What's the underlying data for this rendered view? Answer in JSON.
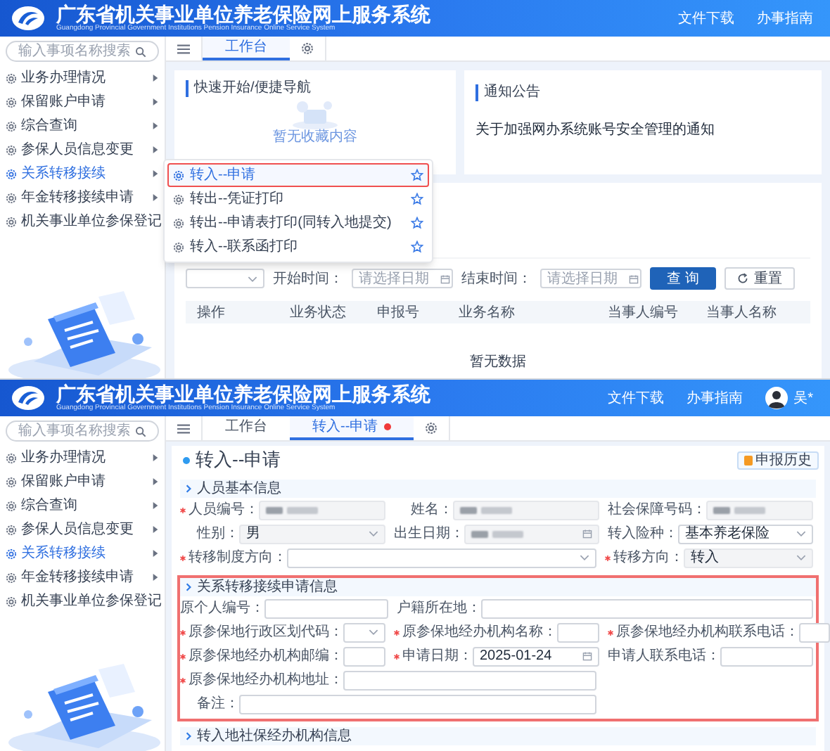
{
  "top_screen": {
    "header": {
      "title": "广东省机关事业单位养老保险网上服务系统",
      "subtitle": "Guangdong Provincial Government Institutions Pension Insurance Online Service System",
      "links": [
        "文件下载",
        "办事指南"
      ]
    },
    "sidebar": {
      "search_placeholder": "输入事项名称搜索",
      "items": [
        {
          "label": "业务办理情况",
          "selected": false
        },
        {
          "label": "保留账户申请",
          "selected": false
        },
        {
          "label": "综合查询",
          "selected": false
        },
        {
          "label": "参保人员信息变更",
          "selected": false
        },
        {
          "label": "关系转移接续",
          "selected": true
        },
        {
          "label": "年金转移接续申请",
          "selected": false
        },
        {
          "label": "机关事业单位参保登记",
          "selected": false
        }
      ]
    },
    "tabs": [
      {
        "kind": "menu",
        "selected": false
      },
      {
        "kind": "text",
        "label": "工作台",
        "selected": true,
        "dot": false
      },
      {
        "kind": "settings",
        "selected": false
      }
    ],
    "quick_nav": {
      "title": "快速开始/便捷导航",
      "empty_text": "暂无收藏内容"
    },
    "notices": {
      "title": "通知公告",
      "items": [
        "关于加强网办系统账号安全管理的通知"
      ]
    },
    "filters": [
      {
        "kind": "select"
      },
      {
        "kind": "date",
        "label": "开始时间：",
        "placeholder": "请选择日期"
      },
      {
        "kind": "date",
        "label": "结束时间：",
        "placeholder": "请选择日期"
      }
    ],
    "buttons": [
      {
        "kind": "primary",
        "label": "查 询"
      },
      {
        "kind": "reset",
        "label": "重置"
      }
    ],
    "table": {
      "columns": [
        "操作",
        "业务状态",
        "申报号",
        "业务名称",
        "当事人编号",
        "当事人名称"
      ],
      "empty_text": "暂无数据"
    },
    "popup_menu": {
      "items": [
        {
          "label": "转入--申请",
          "highlighted": true
        },
        {
          "label": "转出--凭证打印",
          "highlighted": false
        },
        {
          "label": "转出--申请表打印(同转入地提交)",
          "highlighted": false
        },
        {
          "label": "转入--联系函打印",
          "highlighted": false
        }
      ]
    }
  },
  "bottom_screen": {
    "header": {
      "title": "广东省机关事业单位养老保险网上服务系统",
      "subtitle": "Guangdong Provincial Government Institutions Pension Insurance Online Service System",
      "links": [
        "文件下载",
        "办事指南"
      ],
      "user": {
        "name": "吴*"
      }
    },
    "sidebar": {
      "search_placeholder": "输入事项名称搜索",
      "items": [
        {
          "label": "业务办理情况",
          "selected": false
        },
        {
          "label": "保留账户申请",
          "selected": false
        },
        {
          "label": "综合查询",
          "selected": false
        },
        {
          "label": "参保人员信息变更",
          "selected": false
        },
        {
          "label": "关系转移接续",
          "selected": true
        },
        {
          "label": "年金转移接续申请",
          "selected": false
        },
        {
          "label": "机关事业单位参保登记",
          "selected": false
        }
      ]
    },
    "tabs": [
      {
        "kind": "menu",
        "selected": false
      },
      {
        "kind": "text",
        "label": "工作台",
        "selected": false,
        "dot": false
      },
      {
        "kind": "text",
        "label": "转入--申请",
        "selected": true,
        "dot": true
      },
      {
        "kind": "settings",
        "selected": false
      }
    ],
    "page": {
      "title": "转入--申请",
      "history_button": "申报历史"
    },
    "sections": [
      {
        "title": "人员基本信息",
        "highlighted": false,
        "rows": [
          [
            {
              "label": "人员编号：",
              "kind": "text",
              "required": true,
              "disabled": true,
              "redacted": true
            },
            {
              "label": "姓名：",
              "kind": "text",
              "required": false,
              "disabled": true,
              "redacted": true
            },
            {
              "label": "社会保障号码：",
              "kind": "text",
              "required": false,
              "disabled": true,
              "redacted": true
            }
          ],
          [
            {
              "label": "性别：",
              "kind": "select",
              "required": false,
              "disabled": true,
              "value": "男"
            },
            {
              "label": "出生日期：",
              "kind": "date",
              "required": false,
              "disabled": true,
              "redacted": true
            },
            {
              "label": "转入险种：",
              "kind": "select",
              "required": false,
              "disabled": false,
              "value": "基本养老保险"
            }
          ],
          [
            {
              "label": "转移制度方向：",
              "kind": "select",
              "required": true,
              "disabled": false,
              "wide": true
            },
            "",
            {
              "label": "转移方向：",
              "kind": "select",
              "required": true,
              "disabled": true,
              "value": "转入"
            }
          ]
        ]
      },
      {
        "title": "关系转移接续申请信息",
        "highlighted": true,
        "rows": [
          [
            {
              "label": "原个人编号：",
              "kind": "text",
              "required": false,
              "disabled": false
            },
            {
              "label": "户籍所在地：",
              "kind": "text",
              "required": false,
              "disabled": false,
              "wide": true
            }
          ],
          [
            {
              "label": "原参保地行政区划代码：",
              "kind": "select",
              "required": true,
              "disabled": false
            },
            {
              "label": "原参保地经办机构名称：",
              "kind": "text",
              "required": true,
              "disabled": false
            },
            {
              "label": "原参保地经办机构联系电话：",
              "kind": "text",
              "required": true,
              "disabled": false
            }
          ],
          [
            {
              "label": "原参保地经办机构邮编：",
              "kind": "text",
              "required": true,
              "disabled": false
            },
            {
              "label": "申请日期：",
              "kind": "date",
              "required": true,
              "disabled": false,
              "value": "2025-01-24"
            },
            {
              "label": "申请人联系电话：",
              "kind": "text",
              "required": false,
              "disabled": false
            }
          ],
          [
            {
              "label": "原参保地经办机构地址：",
              "kind": "text",
              "required": true,
              "disabled": false,
              "wide": true
            }
          ],
          [
            {
              "label": "备注：",
              "kind": "text",
              "required": false,
              "disabled": false,
              "wide": true
            }
          ]
        ]
      },
      {
        "title": "转入地社保经办机构信息",
        "highlighted": false
      }
    ]
  }
}
